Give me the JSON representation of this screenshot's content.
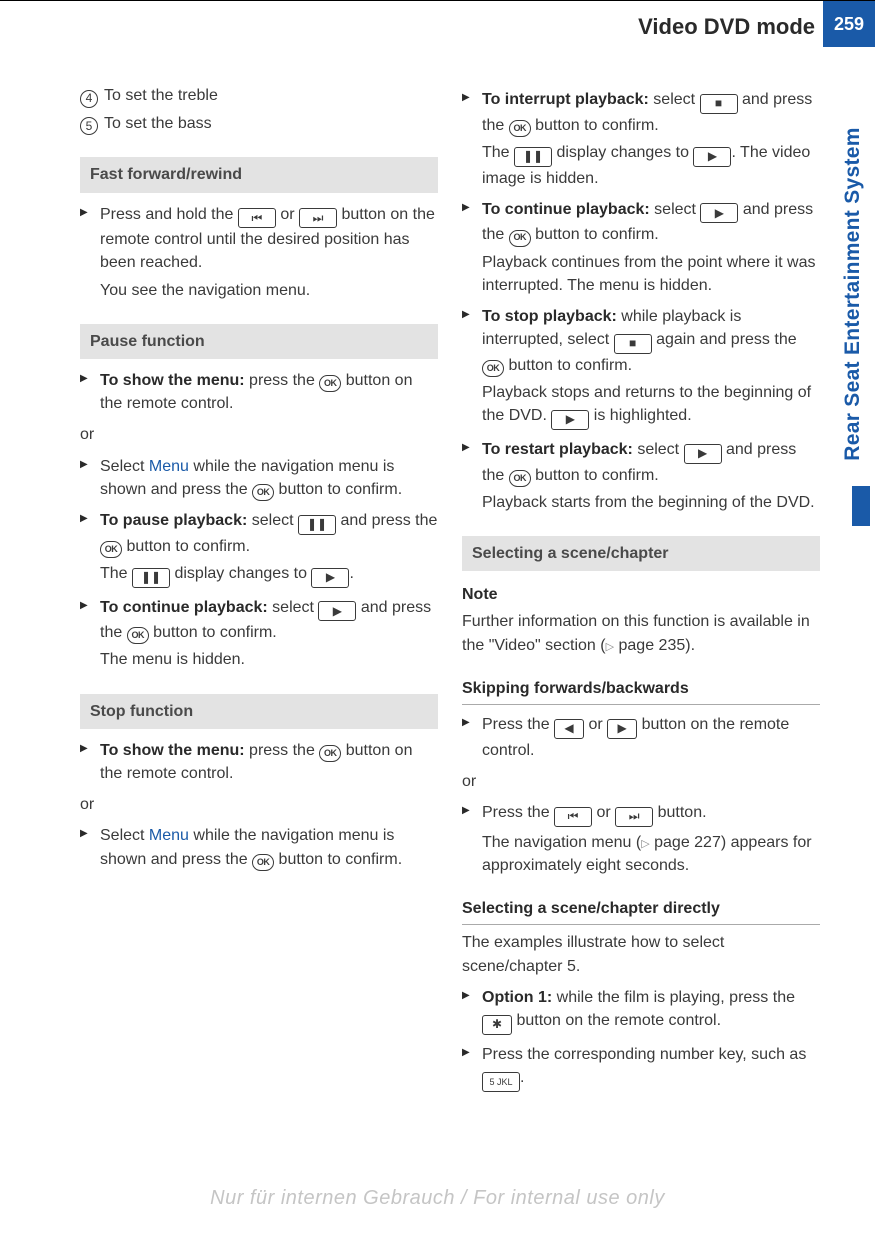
{
  "header": {
    "title": "Video DVD mode",
    "page": "259"
  },
  "side_tab": "Rear Seat Entertainment System",
  "left": {
    "nums": [
      {
        "n": "4",
        "t": "To set the treble"
      },
      {
        "n": "5",
        "t": "To set the bass"
      }
    ],
    "s1_head": "Fast forward/rewind",
    "s1_step_a": "Press and hold the ",
    "s1_step_b": " or ",
    "s1_step_c": " button on the remote control until the desired position has been reached.",
    "s1_sub": "You see the navigation menu.",
    "s2_head": "Pause function",
    "s2_show_bold": "To show the menu:",
    "s2_show_a": " press the ",
    "s2_show_b": " button on the remote control.",
    "or": "or",
    "s2_sel_a": "Select ",
    "s2_sel_menu": "Menu",
    "s2_sel_b": " while the navigation menu is shown and press the ",
    "s2_sel_c": " button to confirm.",
    "s2_pause_bold": "To pause playback:",
    "s2_pause_a": " select ",
    "s2_pause_b": " and press the ",
    "s2_pause_c": " button to confirm.",
    "s2_pause_sub_a": "The ",
    "s2_pause_sub_b": " display changes to ",
    "s2_pause_sub_c": ".",
    "s2_cont_bold": "To continue playback:",
    "s2_cont_a": " select ",
    "s2_cont_b": " and press the ",
    "s2_cont_c": " button to confirm.",
    "s2_cont_sub": "The menu is hidden.",
    "s3_head": "Stop function",
    "s3_show_bold": "To show the menu:",
    "s3_show_a": " press the ",
    "s3_show_b": " button on the remote control.",
    "s3_sel_a": "Select ",
    "s3_sel_b": " while the navigation menu is shown and press the ",
    "s3_sel_c": " button to confirm."
  },
  "right": {
    "intr_bold": "To interrupt playback:",
    "intr_a": " select ",
    "intr_b": " and press the ",
    "intr_c": " button to confirm.",
    "intr_sub_a": "The ",
    "intr_sub_b": " display changes to ",
    "intr_sub_c": ". The video image is hidden.",
    "cont_bold": "To continue playback:",
    "cont_a": " select ",
    "cont_b": " and press the ",
    "cont_c": " button to confirm.",
    "cont_sub": "Playback continues from the point where it was interrupted. The menu is hidden.",
    "stop_bold": "To stop playback:",
    "stop_a": " while playback is interrupted, select ",
    "stop_b": " again and press the ",
    "stop_c": " button to confirm.",
    "stop_sub_a": "Playback stops and returns to the beginning of the DVD. ",
    "stop_sub_b": " is highlighted.",
    "rest_bold": "To restart playback:",
    "rest_a": " select ",
    "rest_b": " and press the ",
    "rest_c": " button to confirm.",
    "rest_sub": "Playback starts from the beginning of the DVD.",
    "sc_head": "Selecting a scene/chapter",
    "note_head": "Note",
    "note_a": "Further information on this function is available in the \"Video\" section (",
    "note_b": " page 235).",
    "skip_head": "Skipping forwards/backwards",
    "skip_a": "Press the ",
    "skip_b": " or ",
    "skip_c": " button on the remote control.",
    "skip2_a": "Press the ",
    "skip2_b": " or ",
    "skip2_c": " button.",
    "skip2_sub_a": "The navigation menu (",
    "skip2_sub_b": " page 227) appears for approximately eight seconds.",
    "direct_head": "Selecting a scene/chapter directly",
    "direct_intro": "The examples illustrate how to select scene/chapter 5.",
    "opt1_bold": "Option 1:",
    "opt1_a": " while the film is playing, press the ",
    "opt1_b": " button on the remote control.",
    "opt2_a": "Press the corresponding number key, such as ",
    "opt2_b": "."
  },
  "icons": {
    "ok": "OK",
    "prev_track": "⏮",
    "next_track": "⏭",
    "pause": "❚❚",
    "play": "▶",
    "stop": "■",
    "left": "◀",
    "right": "▶",
    "star": "✱",
    "five": "5 JKL",
    "pageref": "▷"
  },
  "footer": "Nur für internen Gebrauch / For internal use only"
}
